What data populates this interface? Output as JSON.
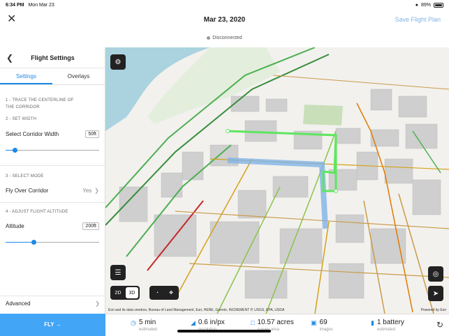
{
  "status_bar": {
    "time": "6:34 PM",
    "date": "Mon Mar 23",
    "battery": "89%"
  },
  "nav": {
    "title": "Mar 23, 2020",
    "save_label": "Save Flight Plan",
    "connection": "Disconnected"
  },
  "panel": {
    "title": "Flight Settings",
    "tabs": [
      {
        "label": "Settings",
        "active": true
      },
      {
        "label": "Overlays",
        "active": false
      }
    ],
    "step1": "1 - TRACE THE CENTERLINE OF THE CORRIDOR",
    "step2": "2 - SET WIDTH",
    "corridor_width_label": "Select Corridor Width",
    "corridor_width_value": "50ft",
    "corridor_width_slider": 0.1,
    "step3": "3 - SELECT MODE",
    "mode_label": "Fly Over Corridor",
    "mode_value": "Yes",
    "step4": "4 - ADJUST FLIGHT ALTITUDE",
    "altitude_label": "Altitude",
    "altitude_value": "200ft",
    "altitude_slider": 0.3,
    "advanced_label": "Advanced",
    "fly_label": "FLY →"
  },
  "map": {
    "view_2d": "2D",
    "view_3d": "3D",
    "attribution": "Esri and its data vendors, Bureau of Land Management, Esri, HERE, Garmin, INCREMENT P, USGS, EPA, USDA",
    "powered_by": "Powered by Esri",
    "icons": [
      "gear-icon",
      "layers-icon",
      "gauge-icon",
      "move-icon",
      "locate-icon",
      "navigate-icon",
      "refresh-icon"
    ]
  },
  "stats": [
    {
      "value": "5 min",
      "label": "estimated",
      "icon": "clock-icon"
    },
    {
      "value": "0.6 in/px",
      "label": "resolution",
      "icon": "resolution-icon"
    },
    {
      "value": "10.57 acres",
      "label": "survey area",
      "icon": "area-icon"
    },
    {
      "value": "69",
      "label": "images",
      "icon": "image-icon"
    },
    {
      "value": "1 battery",
      "label": "estimated",
      "icon": "battery-icon"
    }
  ],
  "colors": {
    "accent": "#42a5f5",
    "flight_path": "#5ee65e",
    "corridor": "#7fb3e6"
  }
}
